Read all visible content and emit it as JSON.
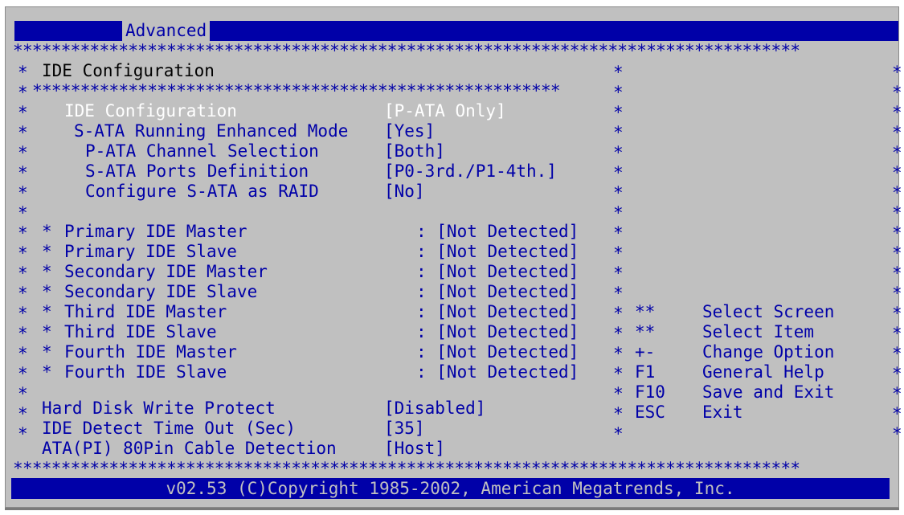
{
  "header": {
    "tab_label": "Advanced"
  },
  "footer": {
    "copyright": "v02.53 (C)Copyright 1985-2002, American Megatrends, Inc."
  },
  "panel": {
    "title": "IDE Configuration",
    "settings": [
      {
        "label": "IDE Configuration",
        "value": "[P-ATA Only]"
      },
      {
        "label": "S-ATA Running Enhanced Mode",
        "value": "[Yes]"
      },
      {
        "label": "P-ATA Channel Selection",
        "value": "[Both]"
      },
      {
        "label": "S-ATA Ports Definition",
        "value": "[P0-3rd./P1-4th.]"
      },
      {
        "label": "Configure S-ATA as RAID",
        "value": "[No]"
      }
    ],
    "drives": [
      {
        "label": "Primary IDE Master",
        "value": ": [Not Detected]"
      },
      {
        "label": "Primary IDE Slave",
        "value": ": [Not Detected]"
      },
      {
        "label": "Secondary IDE Master",
        "value": ": [Not Detected]"
      },
      {
        "label": "Secondary IDE Slave",
        "value": ": [Not Detected]"
      },
      {
        "label": "Third IDE Master",
        "value": ": [Not Detected]"
      },
      {
        "label": "Third IDE Slave",
        "value": ": [Not Detected]"
      },
      {
        "label": "Fourth IDE Master",
        "value": ": [Not Detected]"
      },
      {
        "label": "Fourth IDE Slave",
        "value": ": [Not Detected]"
      }
    ],
    "misc": [
      {
        "label": "Hard Disk Write Protect",
        "value": "[Disabled]"
      },
      {
        "label": "IDE Detect Time Out (Sec)",
        "value": "[35]"
      },
      {
        "label": "ATA(PI) 80Pin Cable Detection",
        "value": "[Host]"
      }
    ]
  },
  "help": {
    "keys": [
      {
        "key": "**",
        "desc": "Select Screen"
      },
      {
        "key": "**",
        "desc": "Select Item"
      },
      {
        "key": "+-",
        "desc": "Change Option"
      },
      {
        "key": "F1",
        "desc": "General Help"
      },
      {
        "key": "F10",
        "desc": "Save and Exit"
      },
      {
        "key": "ESC",
        "desc": "Exit"
      }
    ]
  },
  "border": {
    "full_line": "**********************************************************************************",
    "inner_line": "*******************************************************"
  },
  "colors": {
    "bios_blue": "#0000a8",
    "bios_gray": "#c0c0c0",
    "highlight": "#ffffff"
  }
}
